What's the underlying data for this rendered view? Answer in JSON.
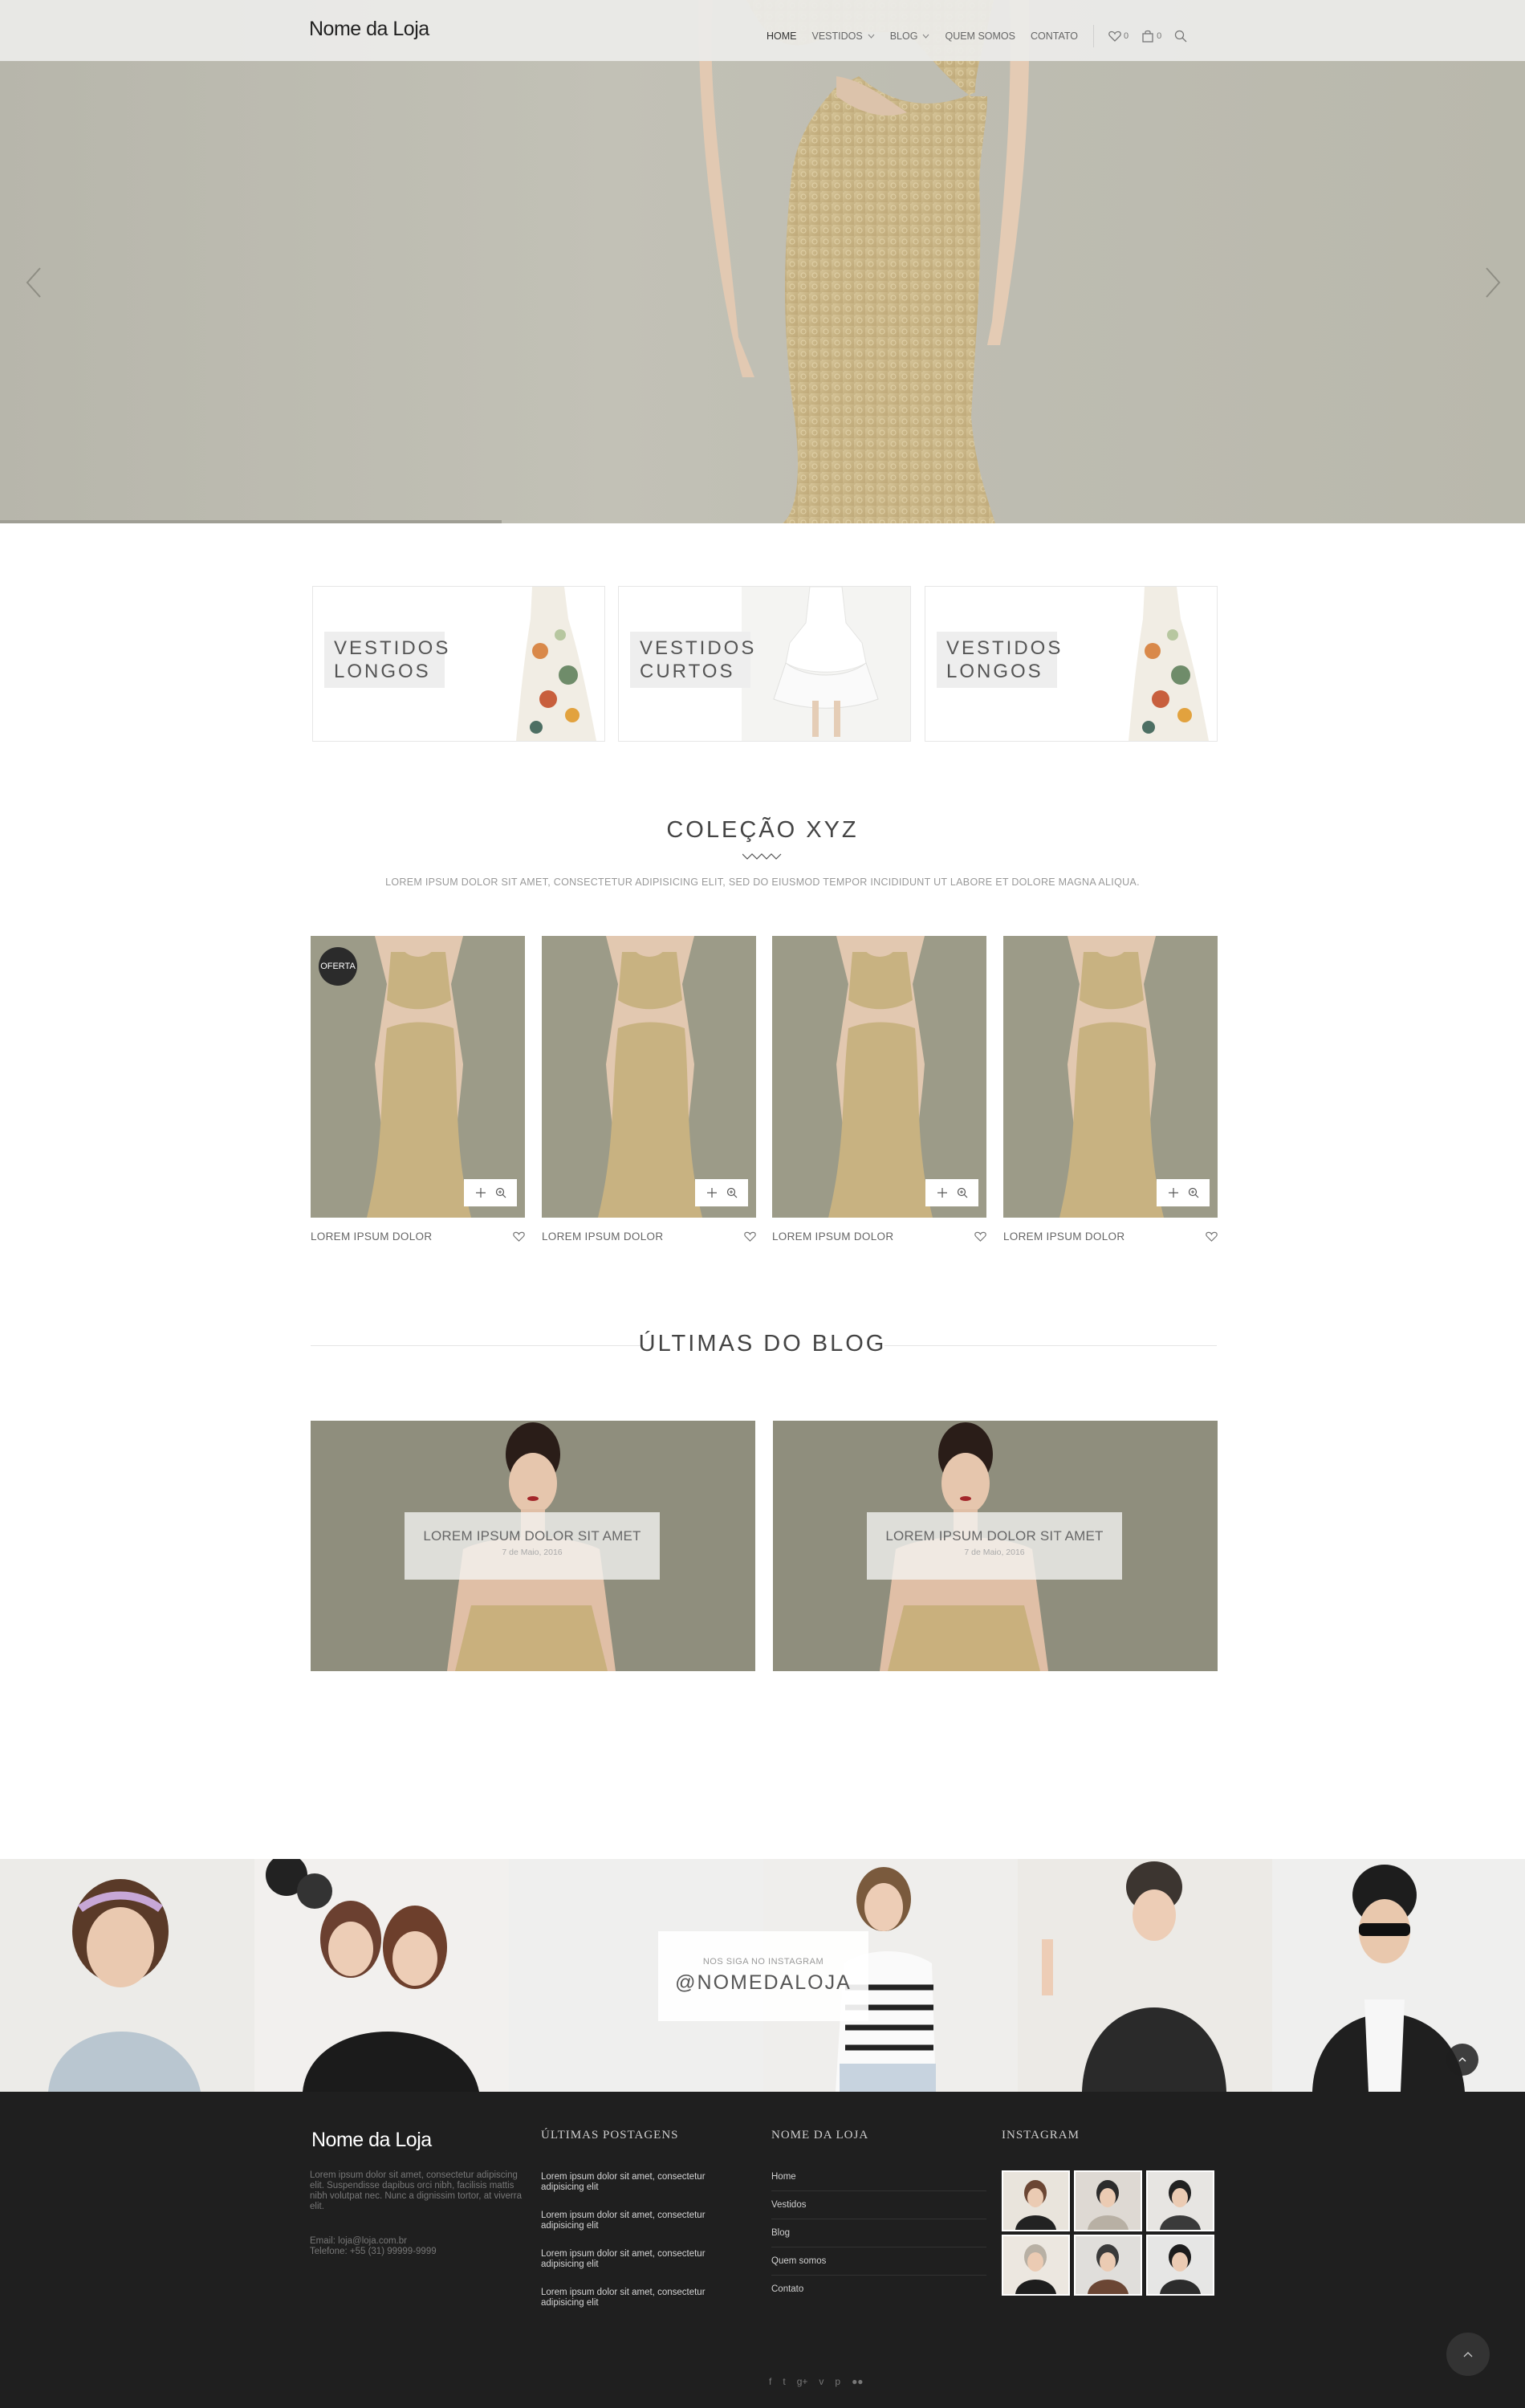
{
  "header": {
    "logo": "Nome da Loja",
    "nav": [
      {
        "label": "HOME",
        "active": true,
        "dropdown": false
      },
      {
        "label": "VESTIDOS",
        "active": false,
        "dropdown": true
      },
      {
        "label": "BLOG",
        "active": false,
        "dropdown": true
      },
      {
        "label": "QUEM SOMOS",
        "active": false,
        "dropdown": false
      },
      {
        "label": "CONTATO",
        "active": false,
        "dropdown": false
      }
    ],
    "wishlist_count": "0",
    "cart_count": "0"
  },
  "categories": [
    {
      "line1": "VESTIDOS",
      "line2": "LONGOS",
      "image": "floral-long-dress"
    },
    {
      "line1": "VESTIDOS",
      "line2": "CURTOS",
      "image": "white-short-dress"
    },
    {
      "line1": "VESTIDOS",
      "line2": "LONGOS",
      "image": "floral-long-dress"
    }
  ],
  "collection": {
    "title": "COLEÇÃO XYZ",
    "subtitle": "LOREM IPSUM DOLOR SIT AMET, CONSECTETUR ADIPISICING ELIT, SED DO EIUSMOD TEMPOR INCIDIDUNT UT LABORE ET DOLORE MAGNA ALIQUA.",
    "products": [
      {
        "name": "LOREM IPSUM DOLOR",
        "badge": "OFERTA"
      },
      {
        "name": "LOREM IPSUM DOLOR",
        "badge": ""
      },
      {
        "name": "LOREM IPSUM DOLOR",
        "badge": ""
      },
      {
        "name": "LOREM IPSUM DOLOR",
        "badge": ""
      }
    ]
  },
  "blog": {
    "title": "ÚLTIMAS DO BLOG",
    "posts": [
      {
        "title": "LOREM IPSUM DOLOR SIT AMET",
        "date": "7 de Maio, 2016"
      },
      {
        "title": "LOREM IPSUM DOLOR SIT AMET",
        "date": "7 de Maio, 2016"
      }
    ]
  },
  "instagram": {
    "small": "NOS SIGA NO INSTAGRAM",
    "handle": "@NOMEDALOJA"
  },
  "footer": {
    "logo": "Nome da Loja",
    "about": "Lorem ipsum dolor sit amet, consectetur adipiscing elit. Suspendisse dapibus orci nibh, facilisis mattis nibh volutpat nec. Nunc a dignissim tortor, at viverra elit.",
    "email": "Email: loja@loja.com.br",
    "phone": "Telefone: +55 (31) 99999-9999",
    "posts_heading": "ÚLTIMAS POSTAGENS",
    "posts": [
      "Lorem ipsum dolor sit amet, consectetur adipisicing elit",
      "Lorem ipsum dolor sit amet, consectetur adipisicing elit",
      "Lorem ipsum dolor sit amet, consectetur adipisicing elit",
      "Lorem ipsum dolor sit amet, consectetur adipisicing elit"
    ],
    "store_heading": "NOME DA LOJA",
    "links": [
      "Home",
      "Vestidos",
      "Blog",
      "Quem somos",
      "Contato"
    ],
    "instagram_heading": "INSTAGRAM",
    "social": [
      "f",
      "t",
      "g+",
      "v",
      "p",
      "flickr"
    ]
  },
  "colors": {
    "hero_bg": "#bdbcb1",
    "product_bg": "#9c9b88",
    "footer_bg": "#1f1f1f",
    "dress_gold": "#c9b58a"
  }
}
